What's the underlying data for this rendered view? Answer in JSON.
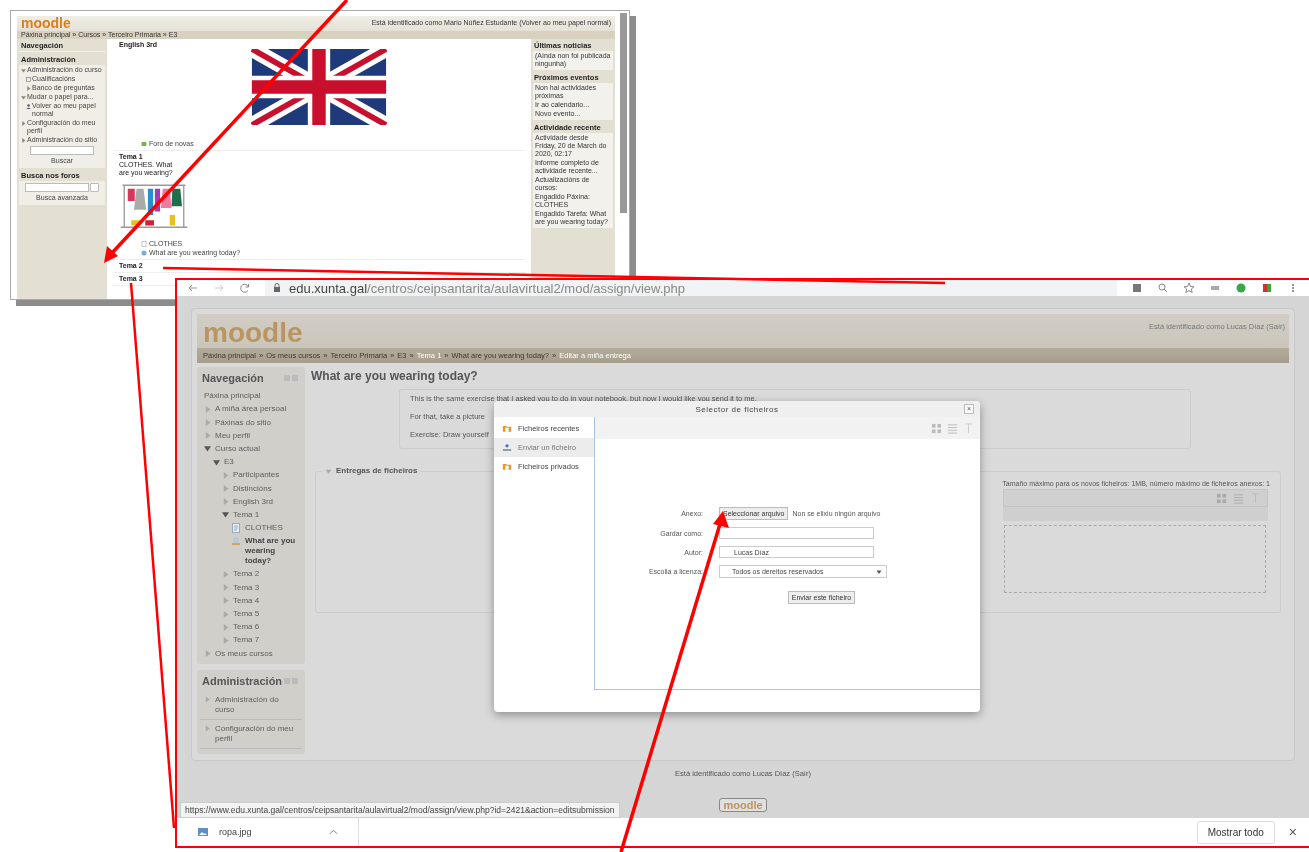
{
  "small": {
    "logo": "moodle",
    "login_info": "Está identificado como Mario Núñez Estudante (Volver ao meu papel normal)",
    "breadcrumb": "Páxina principal » Cursos » Terceiro Primaria » E3",
    "navigation_title": "Navegación",
    "admin_block": {
      "title": "Administración",
      "items": [
        {
          "label": "Administración do curso",
          "kind": "node",
          "expanded": true,
          "children": [
            {
              "label": "Cualificacións",
              "kind": "grades"
            },
            {
              "label": "Banco de preguntas",
              "kind": "node",
              "expanded": false
            }
          ]
        },
        {
          "label": "Mudar o papel para...",
          "kind": "node",
          "expanded": true,
          "children": [
            {
              "label": "Volver ao meu papel normal",
              "kind": "user"
            }
          ]
        },
        {
          "label": "Configuración do meu perfil",
          "kind": "node",
          "expanded": false
        },
        {
          "label": "Administración do sitio",
          "kind": "node",
          "expanded": false
        }
      ],
      "search_button": "Buscar"
    },
    "forum_search": {
      "title": "Busca nos foros",
      "advanced": "Busca avanzada"
    },
    "sections": [
      {
        "title": "English 3rd",
        "kind": "flag",
        "links": [
          {
            "label": "Foro de novas",
            "kind": "forum"
          }
        ]
      },
      {
        "title": "Tema 1",
        "subtitle": "CLOTHES. What are you wearing?",
        "kind": "clothes",
        "links": [
          {
            "label": "CLOTHES",
            "kind": "page"
          },
          {
            "label": "What are you wearing today?",
            "kind": "assign"
          }
        ]
      },
      {
        "title": "Tema 2",
        "kind": "plain"
      },
      {
        "title": "Tema 3",
        "kind": "plain"
      }
    ],
    "right_blocks": [
      {
        "title": "Últimas noticias",
        "lines": [
          "(Aínda non foi publicada ningunha)"
        ]
      },
      {
        "title": "Próximos eventos",
        "lines": [
          "Non hai actividades próximas",
          "Ir ao calendario...",
          "Novo evento..."
        ]
      },
      {
        "title": "Actividade recente",
        "lines": [
          "Actividade desde Friday, 20 de March do 2020, 02:17",
          "Informe completo de actividade recente...",
          "Actualizacións de cursos:",
          "Engadido Páxina: CLOTHES",
          "Engadido Tarefa: What are you wearing today?"
        ]
      }
    ]
  },
  "large": {
    "browser": {
      "url_host": "edu.xunta.gal",
      "url_path": "/centros/ceipsantarita/aulavirtual2/mod/assign/view.php"
    },
    "logo": "moodle",
    "login_info": "Está identificado como Lucas Díaz (Saír)",
    "breadcrumb": [
      {
        "label": "Páxina principal",
        "sep": "»",
        "highlighted": false
      },
      {
        "label": "Os meus cursos",
        "sep": "»",
        "highlighted": false
      },
      {
        "label": "Terceiro Primaria",
        "sep": "»",
        "highlighted": false
      },
      {
        "label": "E3",
        "sep": "»",
        "highlighted": false
      },
      {
        "label": "Tema 1",
        "sep": "»",
        "highlighted": true
      },
      {
        "label": "What are you wearing today?",
        "sep": "»",
        "highlighted": false
      },
      {
        "label": "Editar a miña entrega",
        "highlighted": true
      }
    ],
    "navigation": {
      "title": "Navegación",
      "items": [
        {
          "label": "Páxina principal",
          "kind": "link"
        },
        {
          "label": "A miña área persoal",
          "kind": "node",
          "expanded": false
        },
        {
          "label": "Páxinas do sitio",
          "kind": "node",
          "expanded": false
        },
        {
          "label": "Meu perfil",
          "kind": "node",
          "expanded": false
        },
        {
          "label": "Curso actual",
          "kind": "node",
          "expanded": true,
          "children": [
            {
              "label": "E3",
              "kind": "node",
              "expanded": true,
              "children": [
                {
                  "label": "Participantes",
                  "kind": "node",
                  "expanded": false
                },
                {
                  "label": "Distincións",
                  "kind": "node",
                  "expanded": false
                },
                {
                  "label": "English 3rd",
                  "kind": "node",
                  "expanded": false
                },
                {
                  "label": "Tema 1",
                  "kind": "node",
                  "expanded": true,
                  "children": [
                    {
                      "label": "CLOTHES",
                      "kind": "page",
                      "selected": false
                    },
                    {
                      "label": "What are you wearing today?",
                      "kind": "assign",
                      "selected": true
                    }
                  ]
                },
                {
                  "label": "Tema 2",
                  "kind": "node",
                  "expanded": false
                },
                {
                  "label": "Tema 3",
                  "kind": "node",
                  "expanded": false
                },
                {
                  "label": "Tema 4",
                  "kind": "node",
                  "expanded": false
                },
                {
                  "label": "Tema 5",
                  "kind": "node",
                  "expanded": false
                },
                {
                  "label": "Tema 6",
                  "kind": "node",
                  "expanded": false
                },
                {
                  "label": "Tema 7",
                  "kind": "node",
                  "expanded": false
                }
              ]
            }
          ]
        },
        {
          "label": "Os meus cursos",
          "kind": "node",
          "expanded": false
        }
      ]
    },
    "administration": {
      "title": "Administración",
      "items": [
        {
          "label": "Administración do curso",
          "kind": "node",
          "expanded": false
        },
        {
          "label": "Configuración do meu perfil",
          "kind": "node",
          "expanded": false
        }
      ]
    },
    "main": {
      "title": "What are you wearing today?",
      "description": [
        "This is the same exercise that I asked you to do in your notebook, but now I would like you send it to me.",
        "For that, take a picture",
        "Exercise: Draw yourself"
      ],
      "fieldset": "Entregas de ficheiros",
      "max_size": "Tamaño máximo para os novos ficheiros: 1MB, número máximo de ficheiros anexos: 1"
    },
    "dialog": {
      "title": "Selector de ficheiros",
      "close": "×",
      "repositories": [
        {
          "label": "Ficheiros recentes",
          "kind": "folder",
          "selected": false
        },
        {
          "label": "Enviar un ficheiro",
          "kind": "upload",
          "selected": true
        },
        {
          "label": "Ficheiros privados",
          "kind": "folder",
          "selected": false
        }
      ],
      "form": [
        {
          "kind": "file",
          "label": "Anexo:",
          "button": "Seleccionar arquivo",
          "note": "Non se elixiu ningún arquivo"
        },
        {
          "kind": "text",
          "label": "Gardar como:"
        },
        {
          "kind": "text",
          "label": "Autor:",
          "value": "Lucas Díaz"
        },
        {
          "kind": "select",
          "label": "Escolla a licenza:",
          "value": "Todos os dereitos reservados"
        }
      ],
      "submit": "Enviar este ficheiro"
    },
    "footer_login": "Está identificado como Lucas Díaz (Saír)",
    "footer_logo": "moodle",
    "status_url": "https://www.edu.xunta.gal/centros/ceipsantarita/aulavirtual2/mod/assign/view.php?id=2421&action=editsubmission",
    "download_bar": {
      "file": "ropa.jpg",
      "show_all": "Mostrar todo",
      "close": "×"
    }
  }
}
